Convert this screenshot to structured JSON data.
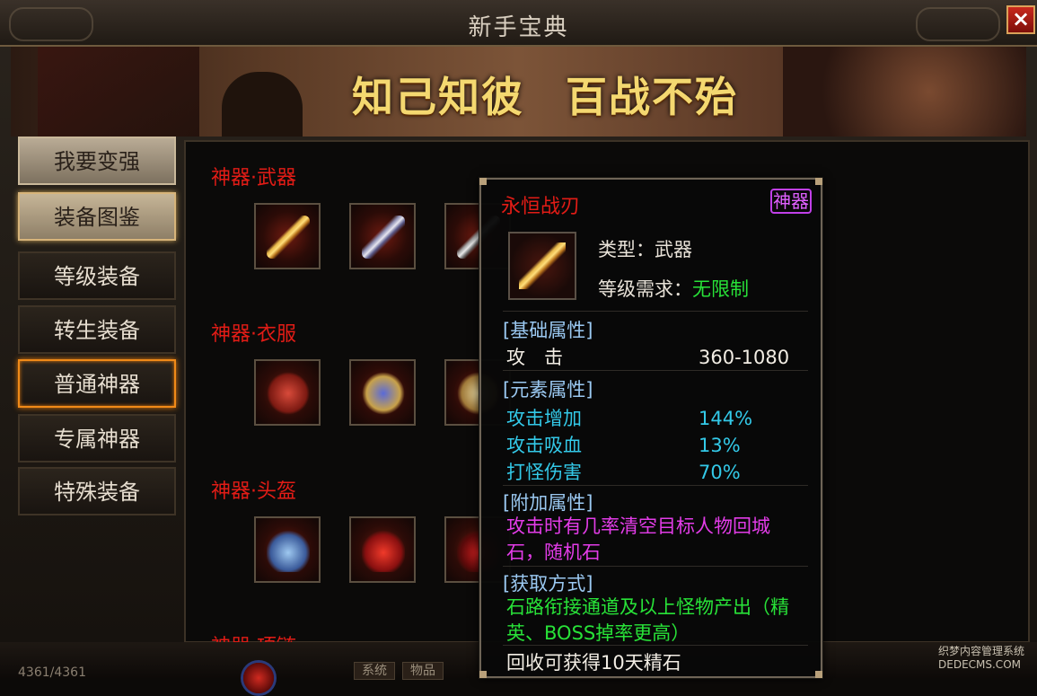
{
  "window": {
    "title": "新手宝典",
    "close_label": "×"
  },
  "banner": {
    "motto_left": "知己知彼",
    "motto_right": "百战不殆"
  },
  "sidebar": {
    "items": [
      {
        "label": "我要变强"
      },
      {
        "label": "装备图鉴"
      },
      {
        "label": "等级装备"
      },
      {
        "label": "转生装备"
      },
      {
        "label": "普通神器"
      },
      {
        "label": "专属神器"
      },
      {
        "label": "特殊装备"
      }
    ]
  },
  "categories": [
    {
      "label": "神器·武器"
    },
    {
      "label": "神器·衣服"
    },
    {
      "label": "神器·头盔"
    },
    {
      "label": "神器·项链"
    }
  ],
  "tooltip": {
    "name": "永恒战刃",
    "badge": "神器",
    "type_label": "类型：",
    "type_value": "武器",
    "level_label": "等级需求：",
    "level_value": "无限制",
    "base_header": "[基础属性]",
    "base": [
      {
        "name": "攻　击",
        "value": "360-1080"
      }
    ],
    "element_header": "[元素属性]",
    "elements": [
      {
        "name": "攻击增加",
        "value": "144%"
      },
      {
        "name": "攻击吸血",
        "value": "13%"
      },
      {
        "name": "打怪伤害",
        "value": "70%"
      }
    ],
    "extra_header": "[附加属性]",
    "extra_text": "攻击时有几率清空目标人物回城石，随机石",
    "source_header": "[获取方式]",
    "source_text": "石路衔接通道及以上怪物产出（精英、BOSS掉率更高）",
    "recycle_text": "回收可获得10天精石"
  },
  "statusbar": {
    "hp": "4361/4361",
    "tab_system": "系统",
    "tab_item": "物品"
  },
  "watermark": {
    "line1": "织梦内容管理系统",
    "line2": "DEDECMS.COM"
  },
  "colors": {
    "category_red": "#e21c16",
    "section_blue": "#9bc9f2",
    "value_cyan": "#33c9e8",
    "magenta": "#e33ce8",
    "green": "#28e238",
    "tab_active_border": "#f08a18"
  }
}
